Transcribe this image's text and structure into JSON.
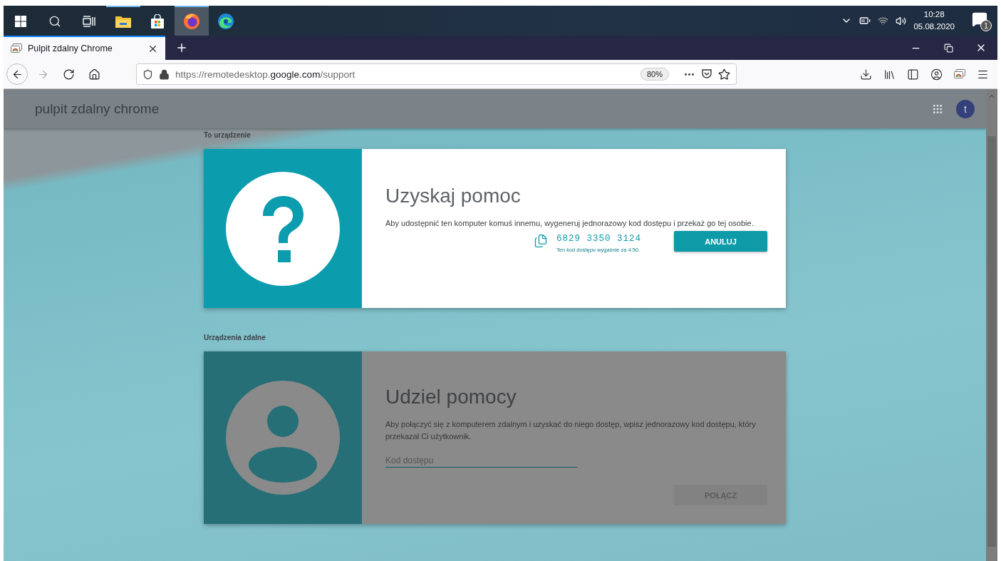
{
  "taskbar": {
    "apps": [
      {
        "kind": "start",
        "running": false,
        "selected": false
      },
      {
        "kind": "search",
        "running": false,
        "selected": false
      },
      {
        "kind": "task-view",
        "running": false,
        "selected": false
      },
      {
        "kind": "file-explorer",
        "running": true,
        "selected": false
      },
      {
        "kind": "store",
        "running": false,
        "selected": false
      },
      {
        "kind": "firefox",
        "running": true,
        "selected": true
      },
      {
        "kind": "edge",
        "running": false,
        "selected": false
      }
    ],
    "tray": {
      "time": "10:28",
      "date": "05.08.2020",
      "notifications": "1"
    }
  },
  "browser": {
    "tab": {
      "title": "Pulpit zdalny Chrome",
      "selected": true
    },
    "url": {
      "prefix": "https://remotedesktop.",
      "domain": "google.com",
      "path": "/support"
    },
    "zoom": "80%"
  },
  "page": {
    "header": {
      "title": "pulpit zdalny chrome",
      "avatar": "t"
    },
    "sections": [
      {
        "label": "To urządzenie",
        "card": {
          "kind": "get-help",
          "highlighted": true,
          "title": "Uzyskaj pomoc",
          "description": "Aby udostępnić ten komputer komuś innemu, wygeneruj jednorazowy kod dostępu i przekaż go tej osobie.",
          "code": "6829 3350 3124",
          "expiry": "Ten kod dostępu wygaśnie za 4:50.",
          "button": {
            "label": "ANULUJ",
            "disabled": false
          }
        }
      },
      {
        "label": "Urządzenia zdalne",
        "card": {
          "kind": "give-help",
          "highlighted": false,
          "title": "Udziel pomocy",
          "description": "Aby połączyć się z komputerem zdalnym i uzyskać do niego dostęp, wpisz jednorazowy kod dostępu, który przekazał Ci użytkownik.",
          "placeholder": "Kod dostępu",
          "button": {
            "label": "POŁĄCZ",
            "disabled": true
          }
        }
      }
    ]
  }
}
